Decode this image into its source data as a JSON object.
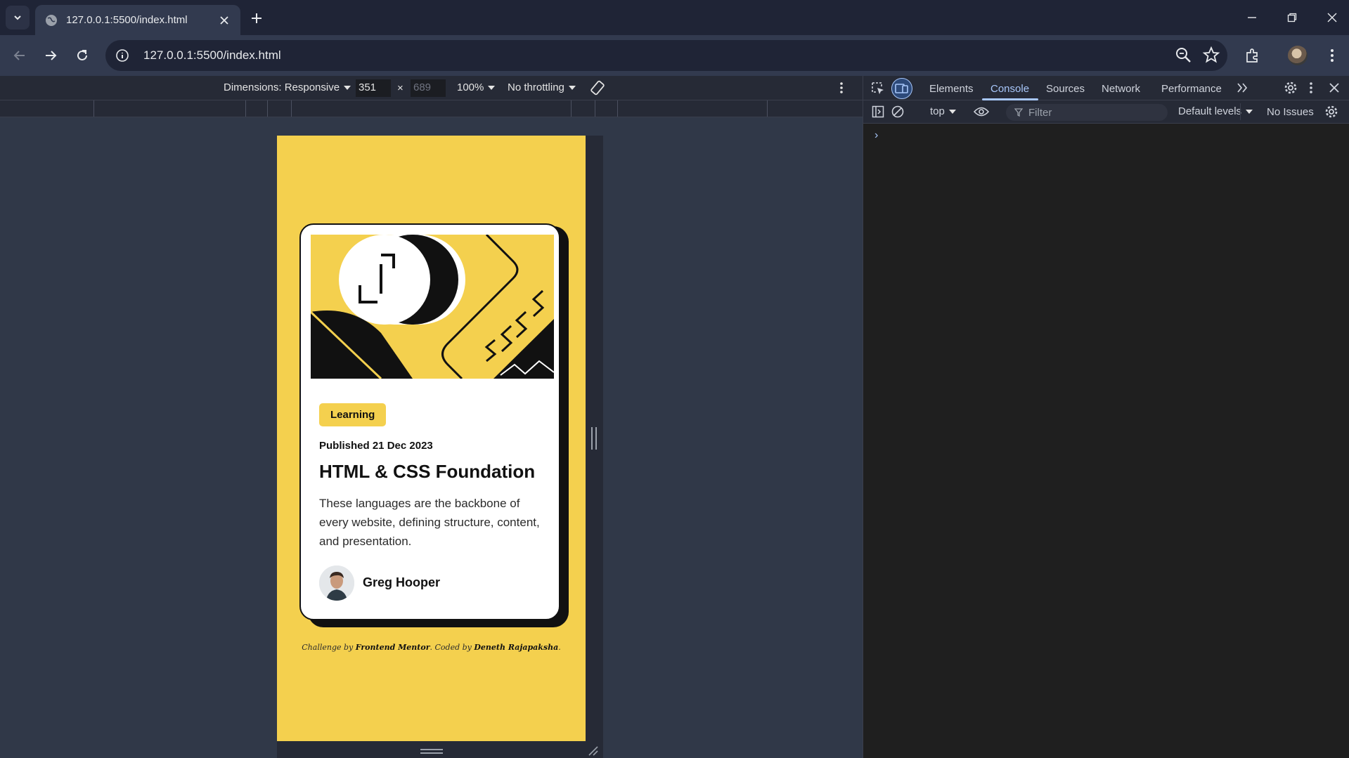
{
  "browser": {
    "tab_title": "127.0.0.1:5500/index.html",
    "url": "127.0.0.1:5500/index.html",
    "icons": [
      "tab-search-icon",
      "globe-icon",
      "close-icon",
      "plus-icon",
      "minimize-icon",
      "restore-icon",
      "window-close-icon",
      "back-icon",
      "forward-icon",
      "reload-icon",
      "site-info-icon",
      "zoom-icon",
      "star-icon",
      "extensions-icon",
      "more-vert-icon"
    ]
  },
  "device_toolbar": {
    "dimensions_label": "Dimensions: Responsive",
    "width": "351",
    "separator": "×",
    "height": "689",
    "zoom": "100%",
    "throttling": "No throttling"
  },
  "page": {
    "background": "#f4d04e",
    "card": {
      "tag": "Learning",
      "published": "Published 21 Dec 2023",
      "title": "HTML & CSS Foundation",
      "description": "These languages are the backbone of every website, defining structure, content, and presentation.",
      "author": "Greg Hooper"
    },
    "attribution": {
      "prefix": "Challenge by",
      "challenge_by": "Frontend Mentor",
      "middle": ". Coded by",
      "coded_by": "Deneth Rajapaksha",
      "suffix": "."
    }
  },
  "devtools": {
    "tabs": [
      "Elements",
      "Console",
      "Sources",
      "Network",
      "Performance"
    ],
    "active_tab": "Console",
    "context": "top",
    "filter_placeholder": "Filter",
    "levels": "Default levels",
    "issues": "No Issues",
    "prompt": "›"
  }
}
